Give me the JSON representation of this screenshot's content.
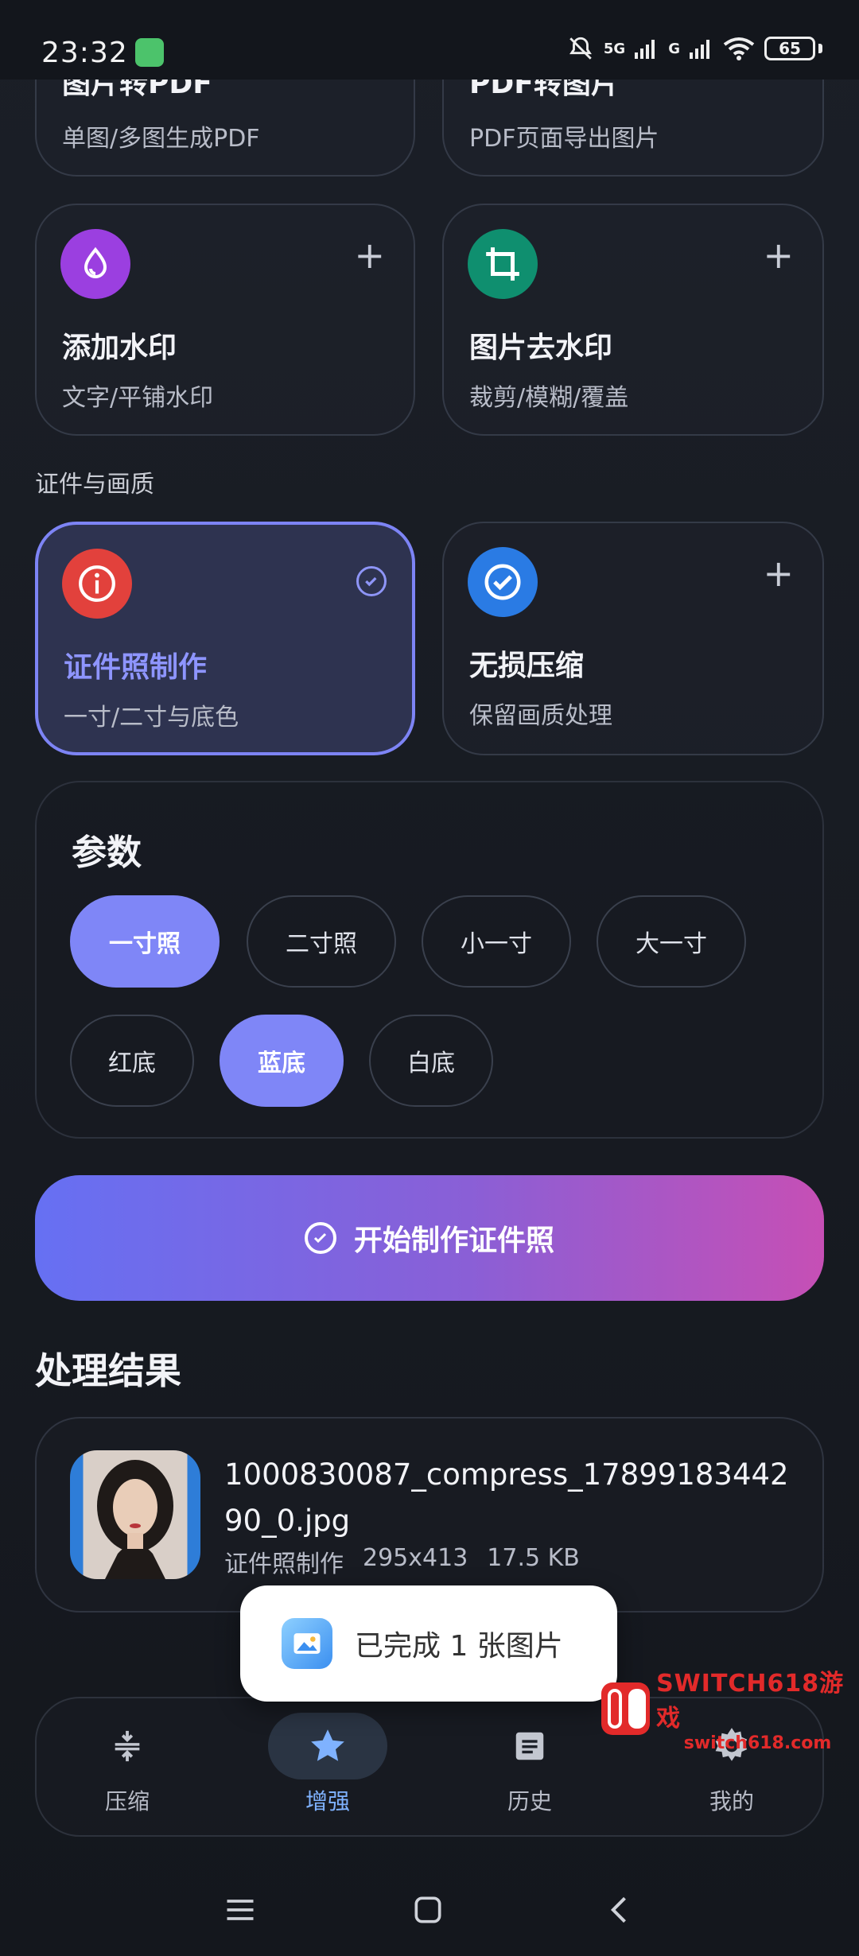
{
  "status_bar": {
    "time": "23:32",
    "network_5g": "5G",
    "network_g": "G",
    "battery": "65"
  },
  "top_cards": [
    {
      "title": "图片转PDF",
      "sub": "单图/多图生成PDF"
    },
    {
      "title": "PDF转图片",
      "sub": "PDF页面导出图片"
    }
  ],
  "tool_cards": [
    {
      "title": "添加水印",
      "sub": "文字/平铺水印",
      "icon": "water-drop-icon",
      "color": "#9b3fe0",
      "state": "add"
    },
    {
      "title": "图片去水印",
      "sub": "裁剪/模糊/覆盖",
      "icon": "crop-icon",
      "color": "#0f8f6f",
      "state": "add"
    }
  ],
  "section_label": "证件与画质",
  "id_cards": [
    {
      "title": "证件照制作",
      "sub": "一寸/二寸与底色",
      "icon": "info-icon",
      "color": "#e2413c",
      "state": "selected"
    },
    {
      "title": "无损压缩",
      "sub": "保留画质处理",
      "icon": "check-circle-icon",
      "color": "#2a7be4",
      "state": "add"
    }
  ],
  "params": {
    "title": "参数",
    "sizes": [
      "一寸照",
      "二寸照",
      "小一寸",
      "大一寸"
    ],
    "size_selected": "一寸照",
    "backgrounds": [
      "红底",
      "蓝底",
      "白底"
    ],
    "background_selected": "蓝底"
  },
  "cta_label": "开始制作证件照",
  "results": {
    "title": "处理结果",
    "items": [
      {
        "file_name": "1000830087_compress_1789918344290_0.jpg",
        "type": "证件照制作",
        "dimensions": "295x413",
        "size": "17.5 KB"
      }
    ]
  },
  "toast": "已完成 1 张图片",
  "watermark": {
    "line1": "SWITCH618游戏",
    "line2": "switch618.com"
  },
  "bottom_nav": [
    {
      "label": "压缩",
      "icon": "compress-icon",
      "active": false
    },
    {
      "label": "增强",
      "icon": "star-icon",
      "active": true
    },
    {
      "label": "历史",
      "icon": "document-icon",
      "active": false
    },
    {
      "label": "我的",
      "icon": "gear-icon",
      "active": false
    }
  ],
  "colors": {
    "accent": "#7f86f7",
    "active_nav": "#7fb2ff"
  }
}
